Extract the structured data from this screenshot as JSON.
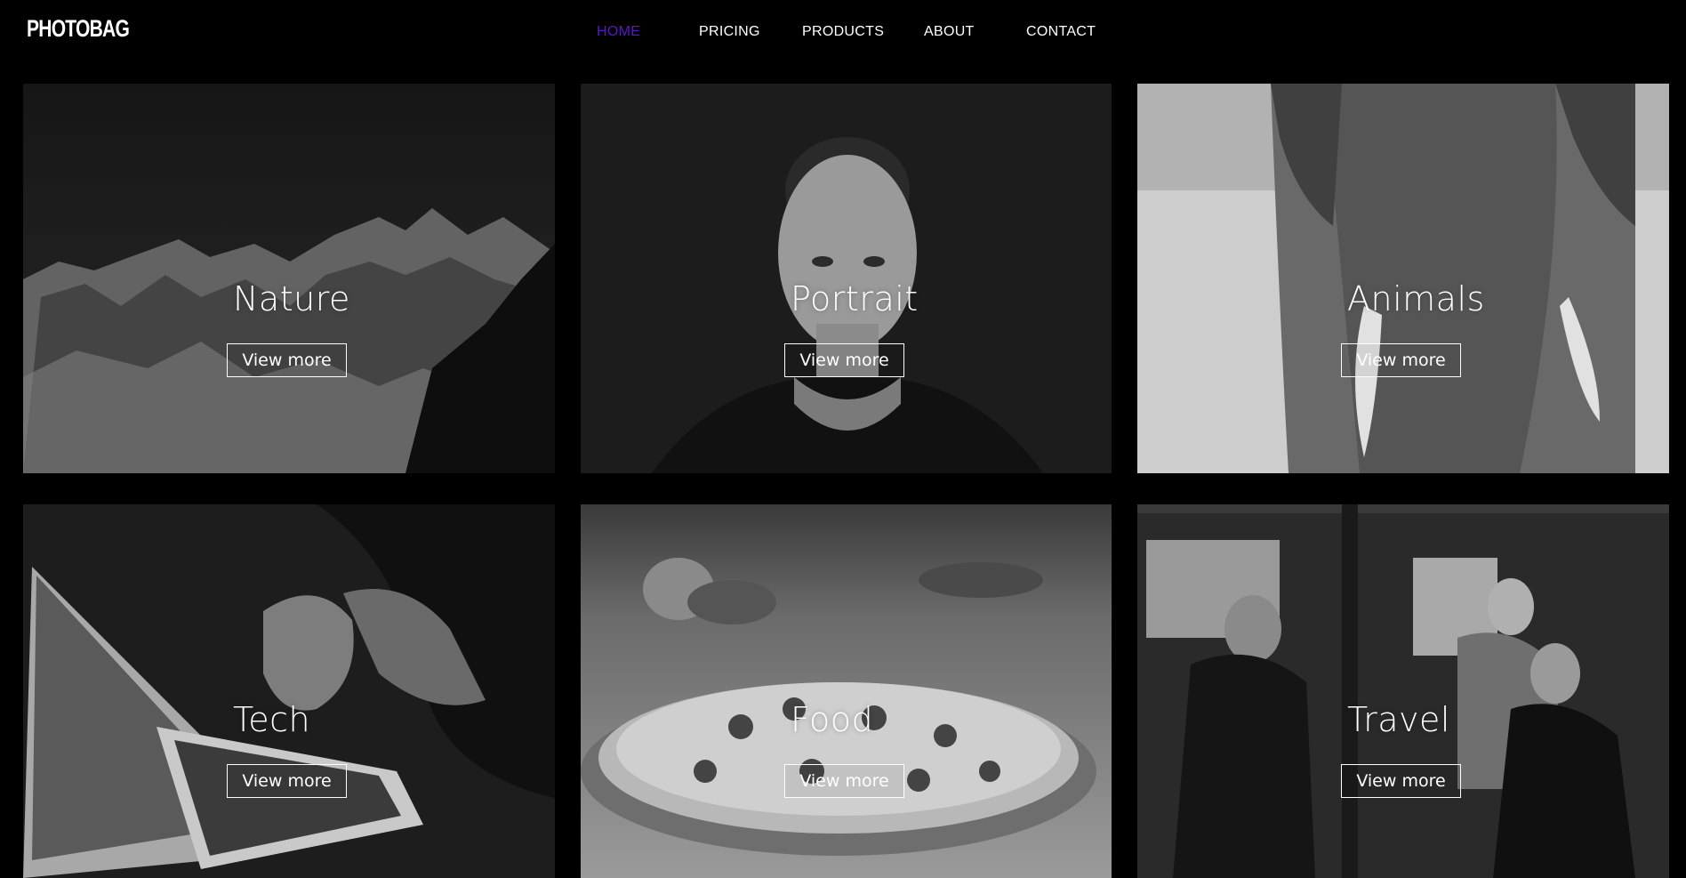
{
  "brand": {
    "logo_text": "PHOTOBAG"
  },
  "nav": {
    "items": [
      {
        "label": "HOME",
        "active": true
      },
      {
        "label": "PRICING",
        "active": false
      },
      {
        "label": "PRODUCTS",
        "active": false
      },
      {
        "label": "ABOUT",
        "active": false
      },
      {
        "label": "CONTACT",
        "active": false
      }
    ],
    "active_color": "#5a17c7"
  },
  "gallery": {
    "button_label": "View more",
    "cards": [
      {
        "title": "Nature",
        "image": "mountain-peaks-photo"
      },
      {
        "title": "Portrait",
        "image": "woman-portrait-photo"
      },
      {
        "title": "Animals",
        "image": "elephant-trunk-photo"
      },
      {
        "title": "Tech",
        "image": "laptop-typing-photo"
      },
      {
        "title": "Food",
        "image": "pizza-on-board-photo"
      },
      {
        "title": "Travel",
        "image": "people-in-van-photo"
      }
    ]
  }
}
